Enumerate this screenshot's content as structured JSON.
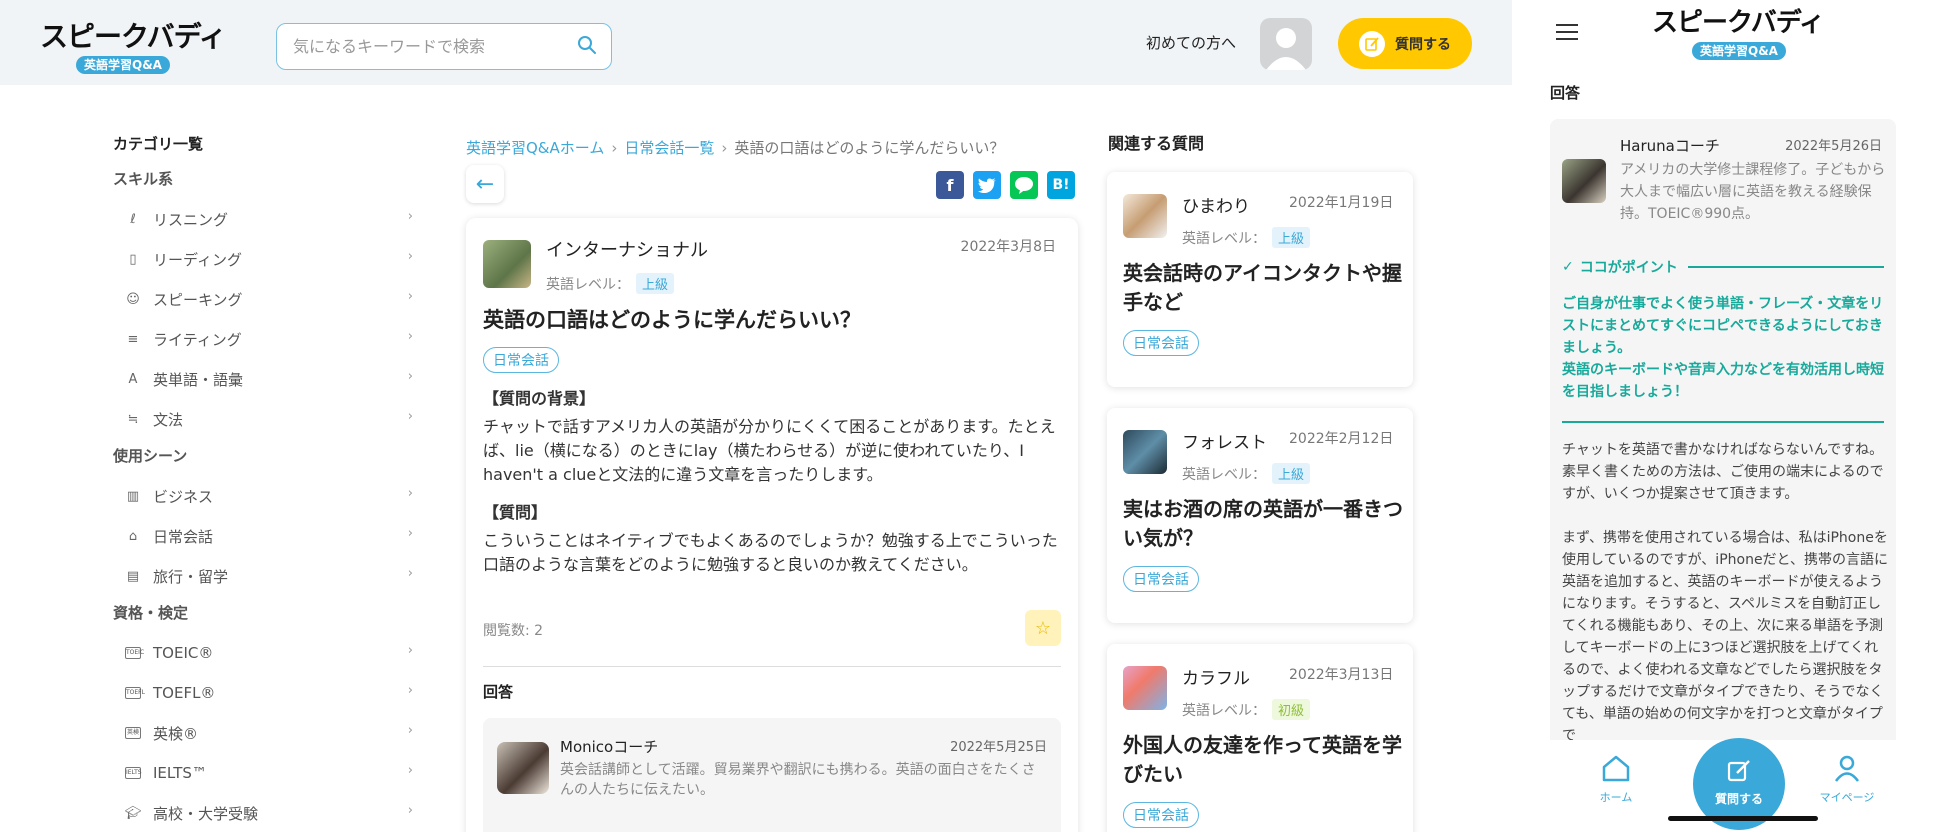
{
  "header": {
    "logo_main": "スピークバディ",
    "logo_sub": "英語学習Q&A",
    "search_placeholder": "気になるキーワードで検索",
    "first_time_link": "初めての方へ",
    "ask_button": "質問する"
  },
  "sidebar": {
    "title": "カテゴリ一覧",
    "groups": [
      {
        "label": "スキル系",
        "items": [
          {
            "label": "リスニング",
            "icon": "ear-icon"
          },
          {
            "label": "リーディング",
            "icon": "book-icon"
          },
          {
            "label": "スピーキング",
            "icon": "speaking-icon"
          },
          {
            "label": "ライティング",
            "icon": "writing-icon"
          },
          {
            "label": "英単語・語彙",
            "icon": "vocabulary-icon"
          },
          {
            "label": "文法",
            "icon": "grammar-icon"
          }
        ]
      },
      {
        "label": "使用シーン",
        "items": [
          {
            "label": "ビジネス",
            "icon": "building-icon"
          },
          {
            "label": "日常会話",
            "icon": "home-icon"
          },
          {
            "label": "旅行・留学",
            "icon": "luggage-icon"
          }
        ]
      },
      {
        "label": "資格・検定",
        "items": [
          {
            "label": "TOEIC®",
            "icon": "toeic-icon",
            "mini": "TOEIC"
          },
          {
            "label": "TOEFL®",
            "icon": "toefl-icon",
            "mini": "TOEFL"
          },
          {
            "label": "英検®",
            "icon": "eiken-icon",
            "mini": "英検"
          },
          {
            "label": "IELTS™",
            "icon": "ielts-icon",
            "mini": "IELTS"
          },
          {
            "label": "高校・大学受験",
            "icon": "graduation-cap-icon"
          }
        ]
      }
    ]
  },
  "breadcrumb": {
    "home": "英語学習Q&Aホーム",
    "category": "日常会話一覧",
    "current": "英語の口語はどのように学んだらいい？"
  },
  "question": {
    "user": "インターナショナル",
    "date": "2022年3月8日",
    "level_label": "英語レベル：",
    "level": "上級",
    "title": "英語の口語はどのように学んだらいい？",
    "category": "日常会話",
    "background_heading": "【質問の背景】",
    "background_text": "チャットで話すアメリカ人の英語が分かりにくくて困ることがあります。たとえば、lie（横になる）のときにlay（横たわらせる）が逆に使われていたり、I haven't a clueと文法的に違う文章を言ったりします。",
    "question_heading": "【質問】",
    "question_text": "こういうことはネイティブでもよくあるのでしょうか？勉強する上でこういった口語のような言葉をどのように勉強すると良いのか教えてください。",
    "views": "閲覧数: 2"
  },
  "answer": {
    "section_title": "回答",
    "coach": "Monicoコーチ",
    "date": "2022年5月25日",
    "bio": "英会話講師として活躍。貿易業界や翻訳にも携わる。英語の面白さをたくさんの人たちに伝えたい。"
  },
  "related": {
    "title": "関連する質問",
    "level_label": "英語レベル：",
    "items": [
      {
        "user": "ひまわり",
        "date": "2022年1月19日",
        "level": "上級",
        "level_color": "blue",
        "question": "英会話時のアイコンタクトや握手など",
        "category": "日常会話"
      },
      {
        "user": "フォレスト",
        "date": "2022年2月12日",
        "level": "上級",
        "level_color": "blue",
        "question": "実はお酒の席の英語が一番きつい気が？",
        "category": "日常会話"
      },
      {
        "user": "カラフル",
        "date": "2022年3月13日",
        "level": "初級",
        "level_color": "green",
        "question": "外国人の友達を作って英語を学びたい",
        "category": "日常会話"
      }
    ]
  },
  "mobile": {
    "logo_main": "スピークバディ",
    "logo_sub": "英語学習Q&A",
    "answer_label": "回答",
    "coach": "Harunaコーチ",
    "date": "2022年5月26日",
    "bio": "アメリカの大学修士課程修了。子どもから大人まで幅広い層に英語を教える経験保持。TOEIC®990点。",
    "point_heading": "ココがポイント",
    "point_text_1": "ご自身が仕事でよく使う単語・フレーズ・文章をリストにまとめてすぐにコピペできるようにしておきましょう。",
    "point_text_2": "英語のキーボードや音声入力などを有効活用し時短を目指しましょう！",
    "answer_p1": "チャットを英語で書かなければならないんですね。素早く書くための方法は、ご使用の端末によるのですが、いくつか提案させて頂きます。",
    "answer_p2": "まず、携帯を使用されている場合は、私はiPhoneを使用しているのですが、iPhoneだと、携帯の言語に英語を追加すると、英語のキーボードが使えるようになります。そうすると、スペルミスを自動訂正してくれる機能もあり、その上、次に来る単語を予測してキーボードの上に3つほど選択肢を上げてくれるので、よく使われる文章などでしたら選択肢をタップするだけで文章がタイプできたり、そうでなくても、単語の始めの何文字かを打つと文章がタイプで",
    "nav_home": "ホーム",
    "nav_ask": "質問する",
    "nav_mypage": "マイページ"
  },
  "colors": {
    "accent_blue": "#3aa8d8",
    "ask_yellow": "#ffc800",
    "point_green": "#18a99b",
    "header_bg": "#f1f4f6"
  }
}
